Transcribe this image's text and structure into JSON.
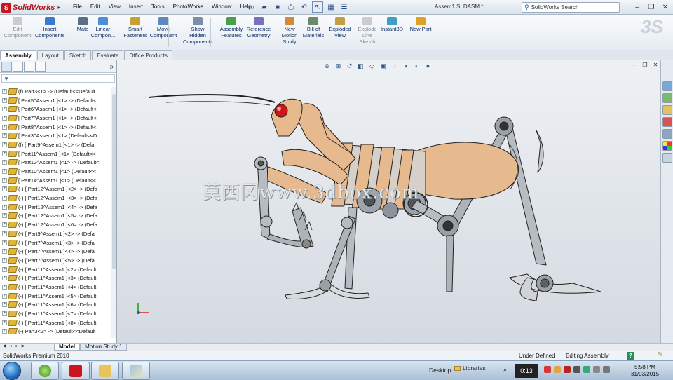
{
  "app": {
    "name": "SolidWorks",
    "menu": [
      "File",
      "Edit",
      "View",
      "Insert",
      "Tools",
      "PhotoWorks",
      "Window",
      "Help"
    ],
    "doc_title": "Assem1.SLDASM *",
    "search_placeholder": "SolidWorks Search"
  },
  "commands": [
    {
      "label": "Edit\nComponent",
      "icon": "edit-component-icon",
      "enabled": false
    },
    {
      "label": "Insert\nComponents",
      "icon": "insert-components-icon",
      "enabled": true
    },
    {
      "label": "Mate",
      "icon": "mate-icon",
      "enabled": true
    },
    {
      "label": "Linear\nCompon...",
      "icon": "linear-pattern-icon",
      "enabled": true
    },
    {
      "label": "Smart\nFasteners",
      "icon": "smart-fasteners-icon",
      "enabled": true
    },
    {
      "label": "Move\nComponent",
      "icon": "move-component-icon",
      "enabled": true
    },
    {
      "label": "Show\nHidden\nComponents",
      "icon": "show-hidden-icon",
      "enabled": true
    },
    {
      "label": "Assembly\nFeatures",
      "icon": "assembly-features-icon",
      "enabled": true
    },
    {
      "label": "Reference\nGeometry",
      "icon": "reference-geometry-icon",
      "enabled": true
    },
    {
      "label": "New\nMotion\nStudy",
      "icon": "motion-study-icon",
      "enabled": true
    },
    {
      "label": "Bill of\nMaterials",
      "icon": "bom-icon",
      "enabled": true
    },
    {
      "label": "Exploded\nView",
      "icon": "exploded-view-icon",
      "enabled": true
    },
    {
      "label": "Explode\nLine\nSketch",
      "icon": "explode-line-icon",
      "enabled": false
    },
    {
      "label": "Instant3D",
      "icon": "instant3d-icon",
      "enabled": true
    },
    {
      "label": "New Part",
      "icon": "new-part-icon",
      "enabled": true
    }
  ],
  "cm_tabs": [
    "Assembly",
    "Layout",
    "Sketch",
    "Evaluate",
    "Office Products"
  ],
  "tree": [
    "(f) Part3<1> -> (Default<<Default",
    "[ Part5^Assem1 ]<1> -> (Default<",
    "[ Part6^Assem1 ]<1> -> (Default<",
    "[ Part7^Assem1 ]<1> -> (Default<",
    "[ Part8^Assem1 ]<1> -> (Default<",
    "[ Part3^Assem1 ]<1> (Default<<D",
    "(f) [ Part9^Assem1 ]<1> -> (Defa",
    "[ Part11^Assem1 ]<1> (Default<<",
    "[ Part12^Assem1 ]<1> -> (Default<",
    "[ Part10^Assem1 ]<1> (Default<<",
    "[ Part14^Assem1 ]<1> (Default<<",
    "(-) [ Part12^Assem1 ]<2> -> (Defa",
    "(-) [ Part12^Assem1 ]<3> -> (Defa",
    "(-) [ Part12^Assem1 ]<4> -> (Defa",
    "(-) [ Part12^Assem1 ]<5> -> (Defa",
    "(-) [ Part12^Assem1 ]<6> -> (Defa",
    "(-) [ Part9^Assem1 ]<2> -> (Defa",
    "(-) [ Part7^Assem1 ]<3> -> (Defa",
    "(-) [ Part7^Assem1 ]<4> -> (Defa",
    "(-) [ Part7^Assem1 ]<5> -> (Defa",
    "(-) [ Part11^Assem1 ]<2> (Default",
    "(-) [ Part11^Assem1 ]<3> (Default",
    "(-) [ Part11^Assem1 ]<4> (Default",
    "(-) [ Part11^Assem1 ]<5> (Default",
    "(-) [ Part11^Assem1 ]<6> (Default",
    "(-) [ Part11^Assem1 ]<7> (Default",
    "(-) [ Part11^Assem1 ]<8> (Default",
    "(-) Part3<2> -> (Default<<Default"
  ],
  "model_tabs": [
    "Model",
    "Motion Study 1"
  ],
  "watermark": "莫西冈www.3dbox.com",
  "status": {
    "product": "SolidWorks Premium 2010",
    "definition": "Under Defined",
    "mode": "Editing Assembly",
    "help": "?"
  },
  "taskbar": {
    "desktop": "Desktop",
    "libraries": "Libraries",
    "timer": "0:13",
    "time": "5:58 PM",
    "date": "31/03/2015"
  },
  "colors": {
    "accent": "#c9151b",
    "body_copper": "#e6b98e",
    "leg_gray": "#b7bcc2",
    "eye_red": "#d0141a"
  }
}
